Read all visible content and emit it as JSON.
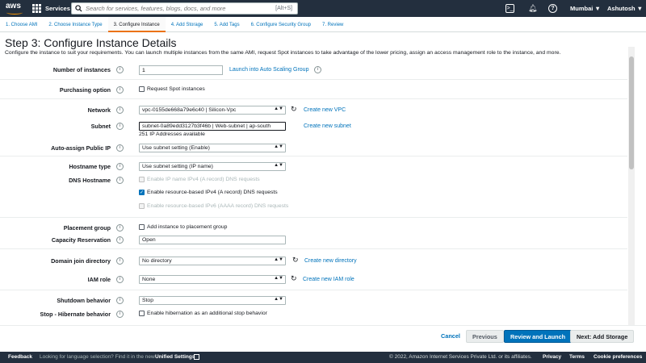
{
  "topbar": {
    "logo": "aws",
    "services": "Services",
    "search_placeholder": "Search for services, features, blogs, docs, and more",
    "search_shortcut": "[Alt+S]",
    "region": "Mumbai ▼",
    "user": "Ashutosh ▼"
  },
  "steps": [
    {
      "label": "1. Choose AMI"
    },
    {
      "label": "2. Choose Instance Type"
    },
    {
      "label": "3. Configure Instance"
    },
    {
      "label": "4. Add Storage"
    },
    {
      "label": "5. Add Tags"
    },
    {
      "label": "6. Configure Security Group"
    },
    {
      "label": "7. Review"
    }
  ],
  "page": {
    "title": "Step 3: Configure Instance Details",
    "subtitle": "Configure the instance to suit your requirements. You can launch multiple instances from the same AMI, request Spot instances to take advantage of the lower pricing, assign an access management role to the instance, and more."
  },
  "form": {
    "num_instances_label": "Number of instances",
    "num_instances_value": "1",
    "auto_scaling_link": "Launch into Auto Scaling Group",
    "purchasing_label": "Purchasing option",
    "spot_label": "Request Spot instances",
    "network_label": "Network",
    "network_value": "vpc-0155de668a79e6c40 | Silicon-Vpc",
    "create_vpc": "Create new VPC",
    "subnet_label": "Subnet",
    "subnet_value": "subnet-0a89edd3127b3f46b | Web-subnet | ap-south",
    "subnet_note": "251 IP Addresses available",
    "create_subnet": "Create new subnet",
    "public_ip_label": "Auto-assign Public IP",
    "public_ip_value": "Use subnet setting (Enable)",
    "hostname_label": "Hostname type",
    "hostname_value": "Use subnet setting (IP name)",
    "dns_label": "DNS Hostname",
    "dns_opt1": "Enable IP name IPv4 (A record) DNS requests",
    "dns_opt2": "Enable resource-based IPv4 (A record) DNS requests",
    "dns_opt3": "Enable resource-based IPv6 (AAAA record) DNS requests",
    "placement_label": "Placement group",
    "placement_opt": "Add instance to placement group",
    "capacity_label": "Capacity Reservation",
    "capacity_value": "Open",
    "domain_label": "Domain join directory",
    "domain_value": "No directory",
    "create_directory": "Create new directory",
    "iam_label": "IAM role",
    "iam_value": "None",
    "create_iam": "Create new IAM role",
    "shutdown_label": "Shutdown behavior",
    "shutdown_value": "Stop",
    "hibernate_label": "Stop - Hibernate behavior",
    "hibernate_opt": "Enable hibernation as an additional stop behavior"
  },
  "buttons": {
    "cancel": "Cancel",
    "previous": "Previous",
    "review": "Review and Launch",
    "next": "Next: Add Storage"
  },
  "footer": {
    "feedback": "Feedback",
    "language": "Looking for language selection? Find it in the new",
    "unified": "Unified Settings",
    "copyright": "© 2022, Amazon Internet Services Private Ltd. or its affiliates.",
    "privacy": "Privacy",
    "terms": "Terms",
    "cookies": "Cookie preferences"
  },
  "colors": {
    "nav": "#232f3e",
    "accent": "#ec7211",
    "primary": "#0073bb"
  }
}
